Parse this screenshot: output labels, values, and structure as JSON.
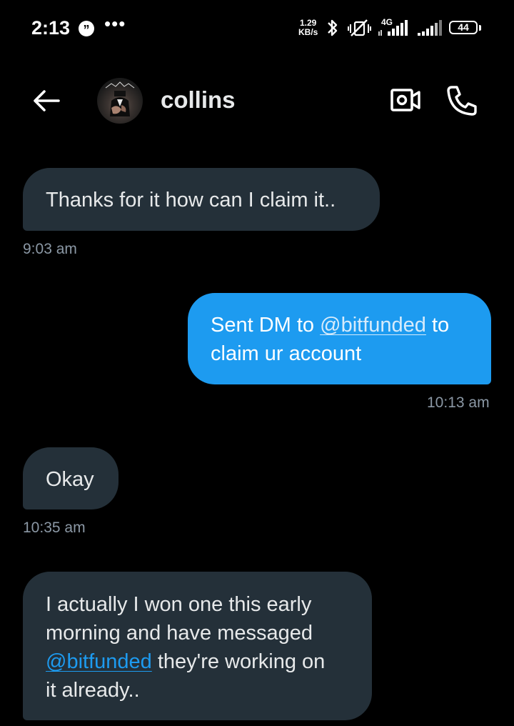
{
  "status_bar": {
    "time": "2:13",
    "notification_icon": "quote-bubble-icon",
    "more_indicator": "•••",
    "net_speed_value": "1.29",
    "net_speed_unit": "KB/s",
    "network_label": "4G",
    "battery": "44"
  },
  "header": {
    "contact_name": "collins",
    "icons": [
      "back-arrow-icon",
      "video-camera-icon",
      "phone-icon"
    ]
  },
  "messages": [
    {
      "direction": "received",
      "parts": [
        "Thanks for it how can I claim it.."
      ],
      "time": "9:03 am"
    },
    {
      "direction": "sent",
      "pre": "Sent DM to ",
      "mention": "@bitfunded",
      "post": " to",
      "line2": "claim ur account",
      "time": "10:13 am"
    },
    {
      "direction": "received",
      "parts": [
        "Okay"
      ],
      "time": "10:35 am"
    },
    {
      "direction": "received",
      "line1": "I actually I won one this early",
      "line2": "morning and have messaged",
      "mention": "@bitfunded",
      "post": " they're working on",
      "line4": "it already.."
    }
  ],
  "colors": {
    "background": "#000000",
    "received_bubble": "#243039",
    "sent_bubble": "#1d9bf0",
    "timestamp": "#8b98a5",
    "mention_link": "#1d9bf0"
  }
}
